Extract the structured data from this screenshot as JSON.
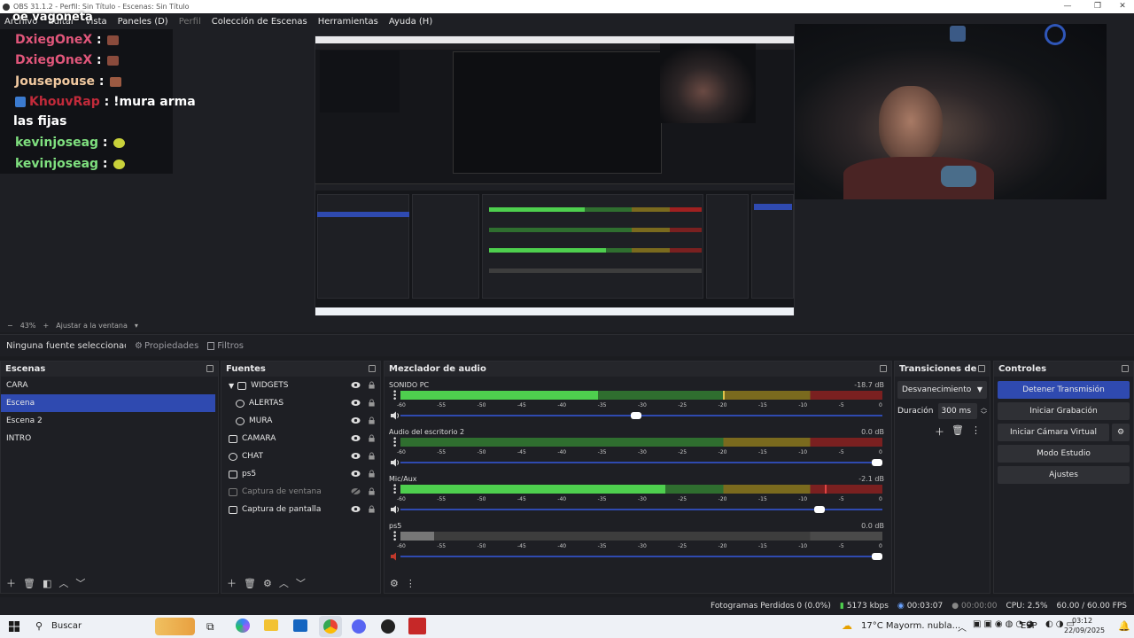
{
  "window": {
    "title": "OBS 31.1.2 - Perfil: Sin Título - Escenas: Sin Título"
  },
  "menu": {
    "items": [
      "Archivo",
      "Editar",
      "Vista",
      "Paneles (D)",
      "Perfil",
      "Colección de Escenas",
      "Herramientas",
      "Ayuda (H)"
    ]
  },
  "overlay_text": "oe vagoneta",
  "chat": {
    "lines": [
      {
        "user": "DxiegOneX",
        "text": "",
        "color": "#e0567a",
        "emote": "#8a4b3c"
      },
      {
        "user": "DxiegOneX",
        "text": "",
        "color": "#e0567a",
        "emote": "#8a4b3c"
      },
      {
        "user": "Jousepouse",
        "text": "",
        "color": "#f1c9a0",
        "emote": "#9c5a42"
      },
      {
        "user": "KhouvRap",
        "text": "!mura arma",
        "cont": "las fijas",
        "color": "#c22a3a",
        "badge": "#3b7bd0"
      },
      {
        "user": "kevinjoseag",
        "text": "",
        "color": "#7fe07f",
        "emote": "#c9d13a"
      },
      {
        "user": "kevinjoseag",
        "text": "",
        "color": "#7fe07f",
        "emote": "#c9d13a"
      }
    ]
  },
  "zoom": {
    "level": "43%",
    "fit": "Ajustar a la ventana"
  },
  "context": {
    "no_source": "Ninguna fuente seleccionada",
    "properties": "Propiedades",
    "filters": "Filtros"
  },
  "scenes": {
    "title": "Escenas",
    "items": [
      "CARA",
      "Escena",
      "Escena 2",
      "INTRO"
    ],
    "selected": 1
  },
  "sources": {
    "title": "Fuentes",
    "items": [
      {
        "label": "WIDGETS",
        "type": "folder",
        "visible": true
      },
      {
        "label": "ALERTAS",
        "type": "browser",
        "visible": true,
        "indent": true
      },
      {
        "label": "MURA",
        "type": "browser",
        "visible": true,
        "indent": true
      },
      {
        "label": "CAMARA",
        "type": "camera",
        "visible": true
      },
      {
        "label": "CHAT",
        "type": "browser",
        "visible": true
      },
      {
        "label": "ps5",
        "type": "camera",
        "visible": true
      },
      {
        "label": "Captura de ventana",
        "type": "window",
        "visible": false
      },
      {
        "label": "Captura de pantalla",
        "type": "display",
        "visible": true
      }
    ]
  },
  "mixer": {
    "title": "Mezclador de audio",
    "ticks": [
      "-60",
      "-55",
      "-50",
      "-45",
      "-40",
      "-35",
      "-30",
      "-25",
      "-20",
      "-15",
      "-10",
      "-5",
      "0"
    ],
    "channels": [
      {
        "name": "SONIDO PC",
        "db": "-18.7 dB",
        "level": 0.41,
        "peak": 0.67,
        "volume": 0.5,
        "active": true
      },
      {
        "name": "Audio del escritorio 2",
        "db": "0.0 dB",
        "level": 0.0,
        "peak": null,
        "volume": 1.0,
        "active": true
      },
      {
        "name": "Mic/Aux",
        "db": "-2.1 dB",
        "level": 0.55,
        "peak": 0.88,
        "volume": 0.88,
        "active": true
      },
      {
        "name": "ps5",
        "db": "0.0 dB",
        "level": 0.07,
        "peak": null,
        "volume": 1.0,
        "active": false
      }
    ]
  },
  "transitions": {
    "title": "Transiciones de e...",
    "selected": "Desvanecimiento",
    "duration_label": "Duración",
    "duration": "300 ms"
  },
  "controls": {
    "title": "Controles",
    "buttons": [
      "Detener Transmisión",
      "Iniciar Grabación",
      "Iniciar Cámara Virtual",
      "Modo Estudio",
      "Ajustes"
    ]
  },
  "status": {
    "dropped": "Fotogramas Perdidos 0 (0.0%)",
    "bitrate": "5173 kbps",
    "stream_time": "00:03:07",
    "rec_time": "00:00:00",
    "cpu": "CPU: 2.5%",
    "fps": "60.00 / 60.00 FPS"
  },
  "taskbar": {
    "search": "Buscar",
    "weather": "17°C  Mayorm. nubla...",
    "lang": "ESP",
    "time": "03:12",
    "date": "22/09/2025"
  },
  "colors": {
    "accent": "#2f4ab0",
    "meter_green": "#4ecf4e",
    "meter_yellow": "#7a6a1e",
    "meter_red": "#7a2020"
  }
}
